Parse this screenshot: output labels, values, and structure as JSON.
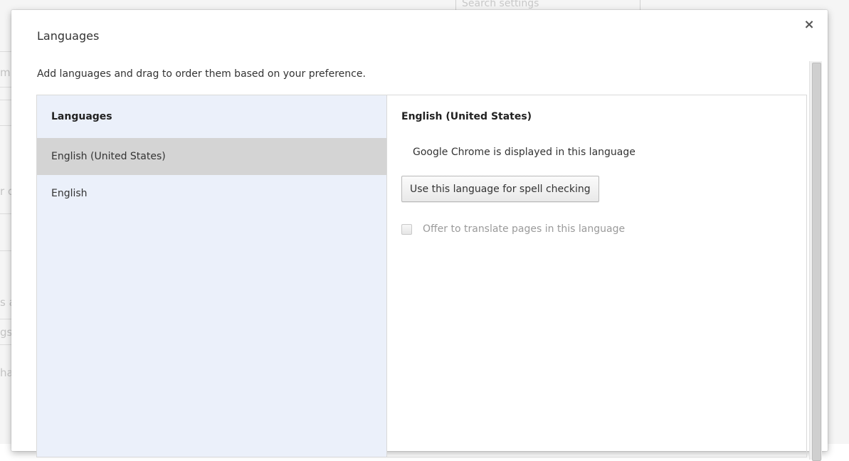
{
  "background": {
    "search_placeholder": "Search settings",
    "fragments": [
      "m",
      "r c",
      "s a",
      "gs",
      "ha"
    ]
  },
  "dialog": {
    "title": "Languages",
    "close_icon": "×",
    "description": "Add languages and drag to order them based on your preference.",
    "list": {
      "header": "Languages",
      "items": [
        {
          "label": "English (United States)",
          "selected": true
        },
        {
          "label": "English",
          "selected": false
        }
      ]
    },
    "detail": {
      "title": "English (United States)",
      "display_note": "Google Chrome is displayed in this language",
      "spell_button": "Use this language for spell checking",
      "translate_label": "Offer to translate pages in this language",
      "translate_checked": false
    }
  },
  "colors": {
    "list_background": "#ebf0fa",
    "selected_row": "#d4d4d4"
  }
}
